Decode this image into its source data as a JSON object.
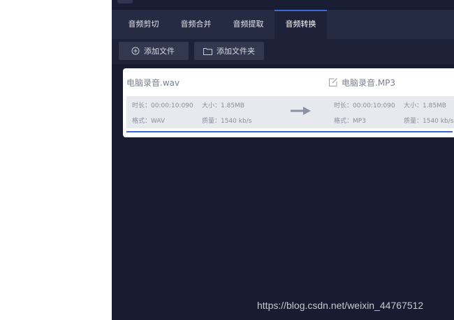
{
  "tabs": [
    {
      "label": "音频剪切"
    },
    {
      "label": "音频合并"
    },
    {
      "label": "音频提取"
    },
    {
      "label": "音频转换",
      "active": true
    }
  ],
  "toolbar": {
    "add_file_label": "添加文件",
    "add_folder_label": "添加文件夹"
  },
  "file": {
    "source": {
      "name": "电脑录音.wav",
      "duration": "时长：00:00:10:090",
      "size": "大小：1.85MB",
      "format": "格式：WAV",
      "quality": "质量：1540 kb/s"
    },
    "target": {
      "name": "电脑录音.MP3",
      "duration": "时长：00:00:10:090",
      "size": "大小：1.85MB",
      "format": "格式：MP3",
      "quality": "质量：1540 kb/s"
    }
  },
  "watermark": "https://blog.csdn.net/weixin_44767512",
  "colors": {
    "accent": "#3a6ad8",
    "background": "#181c32",
    "tab_bar": "#262b44",
    "button": "#323850"
  },
  "icons": {
    "add": "plus-circle-icon",
    "folder": "folder-icon",
    "edit": "edit-icon",
    "convert": "arrow-right-icon"
  }
}
